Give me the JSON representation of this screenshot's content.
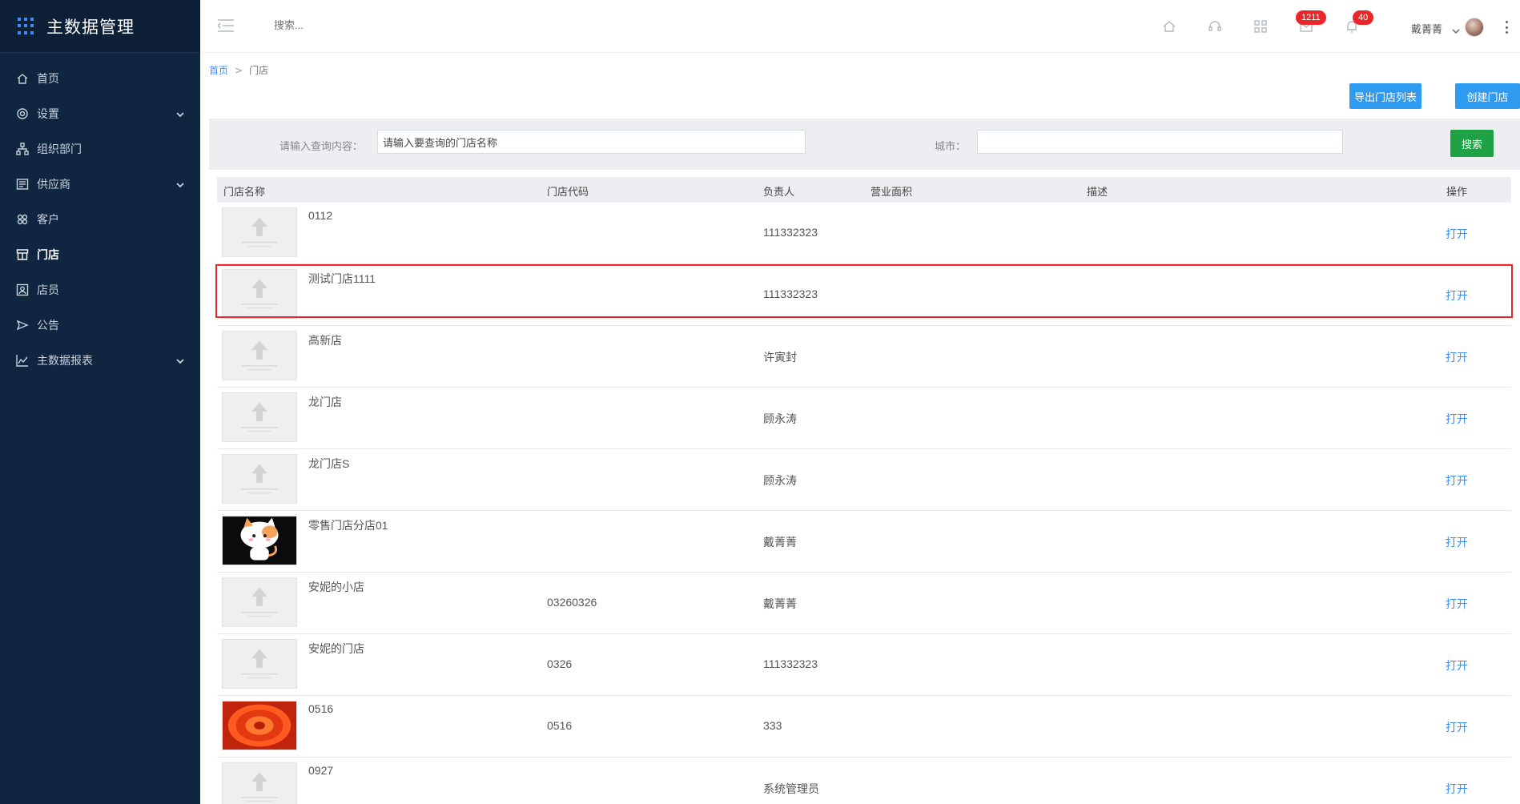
{
  "sidebar": {
    "title": "主数据管理",
    "items": [
      {
        "label": "首页",
        "icon": "home-icon",
        "expandable": false,
        "active": false
      },
      {
        "label": "设置",
        "icon": "gear-icon",
        "expandable": true,
        "active": false
      },
      {
        "label": "组织部门",
        "icon": "org-chart-icon",
        "expandable": false,
        "active": false
      },
      {
        "label": "供应商",
        "icon": "supplier-icon",
        "expandable": true,
        "active": false
      },
      {
        "label": "客户",
        "icon": "customer-icon",
        "expandable": false,
        "active": false
      },
      {
        "label": "门店",
        "icon": "store-icon",
        "expandable": false,
        "active": true
      },
      {
        "label": "店员",
        "icon": "staff-icon",
        "expandable": false,
        "active": false
      },
      {
        "label": "公告",
        "icon": "announcement-icon",
        "expandable": false,
        "active": false
      },
      {
        "label": "主数据报表",
        "icon": "chart-icon",
        "expandable": true,
        "active": false
      }
    ]
  },
  "header": {
    "search_placeholder": "搜索...",
    "badges": {
      "messages": "1211",
      "notifications": "40"
    },
    "username": "戴菁菁"
  },
  "breadcrumb": {
    "home": "首页",
    "separator": ">",
    "current": "门店"
  },
  "actions": {
    "export_label": "导出门店列表",
    "create_label": "创建门店"
  },
  "filter": {
    "query_label": "请输入查询内容：",
    "query_value": "请输入要查询的门店名称",
    "city_label": "城市：",
    "city_value": "",
    "search_label": "搜索"
  },
  "table": {
    "headers": {
      "name": "门店名称",
      "code": "门店代码",
      "manager": "负责人",
      "area": "营业面积",
      "desc": "描述",
      "action": "操作"
    },
    "rows": [
      {
        "name": "0112",
        "code": "",
        "manager": "111332323",
        "action": "打开",
        "thumb": "placeholder"
      },
      {
        "name": "测试门店1111",
        "code": "",
        "manager": "111332323",
        "action": "打开",
        "thumb": "placeholder",
        "highlighted": true
      },
      {
        "name": "高新店",
        "code": "",
        "manager": "许寅封",
        "action": "打开",
        "thumb": "placeholder"
      },
      {
        "name": "龙门店",
        "code": "",
        "manager": "顾永涛",
        "action": "打开",
        "thumb": "placeholder"
      },
      {
        "name": "龙门店S",
        "code": "",
        "manager": "顾永涛",
        "action": "打开",
        "thumb": "placeholder"
      },
      {
        "name": "零售门店分店01",
        "code": "",
        "manager": "戴菁菁",
        "action": "打开",
        "thumb": "cat"
      },
      {
        "name": "安妮的小店",
        "code": "03260326",
        "manager": "戴菁菁",
        "action": "打开",
        "thumb": "placeholder"
      },
      {
        "name": "安妮的门店",
        "code": "0326",
        "manager": "111332323",
        "action": "打开",
        "thumb": "placeholder"
      },
      {
        "name": "0516",
        "code": "0516",
        "manager": "333",
        "action": "打开",
        "thumb": "flower"
      },
      {
        "name": "0927",
        "code": "",
        "manager": "系统管理员",
        "action": "打开",
        "thumb": "placeholder"
      }
    ]
  },
  "colors": {
    "sidebar_bg": "#0f2540",
    "primary": "#2e9bf0",
    "success": "#1fa245",
    "badge": "#e9262a",
    "highlight": "#e8262b"
  }
}
